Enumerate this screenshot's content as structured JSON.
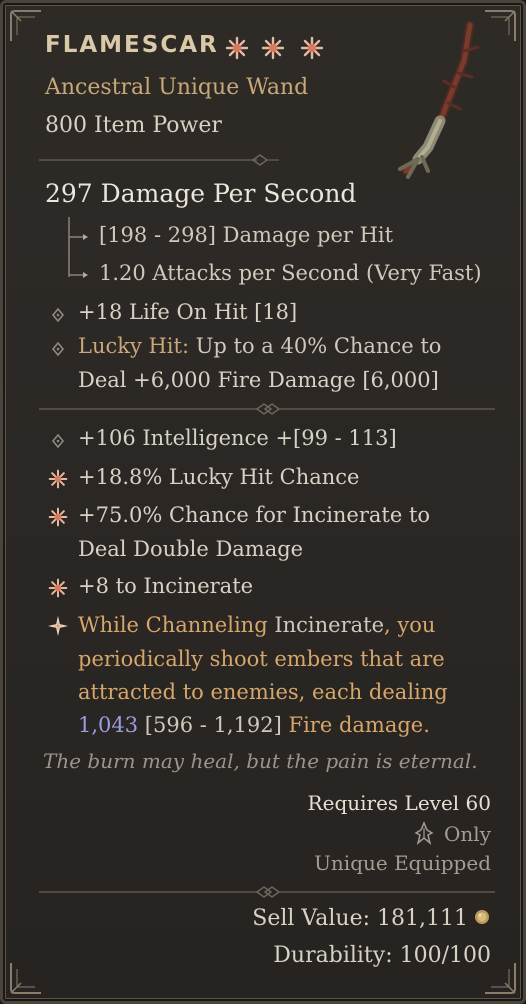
{
  "item": {
    "name": "FLAMESCAR",
    "type_line": "Ancestral Unique Wand",
    "item_power": "800 Item Power",
    "title_star_icon": "unique-star-icon"
  },
  "weapon": {
    "dps": "297 Damage Per Second",
    "damage_per_hit": "[198 - 298] Damage per Hit",
    "attack_speed": "1.20 Attacks per Second (Very Fast)"
  },
  "implicits": [
    {
      "text": "+18 Life On Hit [18]"
    },
    {
      "label": "Lucky Hit:",
      "line1": " Up to a 40% Chance to",
      "line2": "Deal +6,000 Fire Damage [6,000]"
    }
  ],
  "affixes": [
    {
      "text": "+106 Intelligence +[99 - 113]",
      "icon": "diamond-bullet-icon"
    },
    {
      "text": "+18.8% Lucky Hit Chance",
      "icon": "greater-affix-star-icon"
    },
    {
      "line1": "+75.0% Chance for Incinerate to",
      "line2": "Deal Double Damage",
      "icon": "greater-affix-star-icon"
    },
    {
      "text": "+8 to Incinerate",
      "icon": "greater-affix-star-icon"
    }
  ],
  "unique_power": {
    "icon": "unique-power-icon",
    "l1a": "While Channeling",
    "l1b": " Incinerate",
    "l1c": ", you",
    "l2": "periodically shoot embers that are",
    "l3": "attracted to enemies, each dealing",
    "l4a": "1,043",
    "l4b": " [596 - 1,192]",
    "l4c": " Fire damage."
  },
  "flavor": "The burn may heal, but the pain is eternal.",
  "requirements": {
    "level": "Requires Level 60",
    "class_only": "Only",
    "class_icon": "sorcerer-class-icon",
    "equip": "Unique Equipped"
  },
  "footer": {
    "sell": "Sell Value: 181,111",
    "gold_icon": "gold-coin-icon",
    "durability": "Durability: 100/100"
  },
  "colors": {
    "unique_gold": "#d7a66a",
    "lucky_hit": "#c8a878",
    "rolled_value_blue": "#9a9ee0",
    "star": "#e08a6a"
  }
}
